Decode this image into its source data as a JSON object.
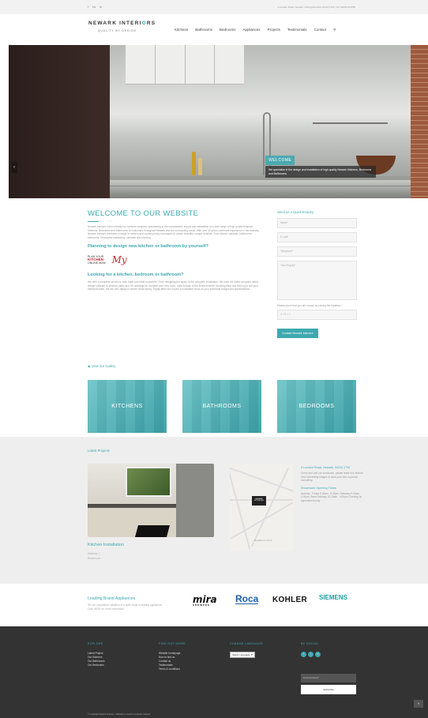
{
  "topbar": {
    "social": [
      "f",
      "tw",
      "in"
    ],
    "info": "4 London Road, Newark, Nottinghamshire NG24 1TW | Tel: 01636 611789"
  },
  "logo": {
    "name_a": "NEWARK INTERI",
    "name_b": "O",
    "name_c": "RS",
    "tagline": "QUALITY BY DESIGN"
  },
  "nav": [
    "Kitchens",
    "Bathrooms",
    "Bedrooms",
    "Appliances",
    "Projects",
    "Testimonials",
    "Contact"
  ],
  "hero": {
    "caption_title": "WELCOME",
    "caption_text": "We specialise in the design and installation of high quality Newark Kitchens, Bedrooms and Bathrooms"
  },
  "main": {
    "title": "WELCOME TO OUR WEBSITE",
    "intro": "Newark Interiors Ltd is a family run furniture company specialising in the manufacture, supply and installation of a wide range of high quality bespoke Kitchens, Bedrooms and Bathrooms to customers throughout Newark and the surrounding areas. With over 30 years combined experience in the industry, Newark Interiors combines a range of modern and contemporary techniques to create beautiful, unique furniture. From kitchen cabinets, bathrooms, bedrooms, to bespoke wardrobes, cabinets and shelving.",
    "plan_title": "Planning to design new kitchen or bathroom by yourself?",
    "kit_line1": "PLAN YOUR",
    "kit_line2": "KITCHEN",
    "kit_line3": "ONLINE NOW",
    "kit_brand": "My",
    "look_title": "Looking for a kitchen, bedroom or bathroom?",
    "look_text": "We offer a complete service to both trade and retail customers. From designing the layout to the complete installation. We have the latest computer aided design software to produce plans and 3D drawings for visualize your new room, right through to the finished article including tiling and flooring to suit your individual taste. We are also happy to advise those laying. Tightly fitted can expect a consistent focus on your individual budget and specifications."
  },
  "form": {
    "title": "Send us a Quick Enquiry",
    "name": "Name*",
    "email": "E-mail*",
    "telephone": "Telephone*",
    "company": "Your Enquiry*",
    "question": "Please prove that you are human by solving the equation *",
    "answer": "4 + 5 = ?",
    "button": "Contact Newark Interiors"
  },
  "gallery": {
    "link": "View our Gallery",
    "tiles": [
      "KITCHENS",
      "BATHROOMS",
      "BEDROOMS"
    ]
  },
  "projects": {
    "title": "Latest Projects",
    "project_name": "Kitchen Installation",
    "project_sub": "Kitchens, 1",
    "read_more": "Read more ›"
  },
  "map": {
    "pin": "NEWARK INTERIORS",
    "label": "Newark-on-Trent"
  },
  "contact": {
    "address": "4 London Road, Newark, NG24 1TW",
    "desc": "Come and visit our showroom, please leave it to feature new/ interesting images or lawn your free in-person consulting.",
    "hours_title": "Showroom Opening Times",
    "hours": "Monday - Friday 9.00am - 5.30pm, Saturday 9.00am - 1.00pm, Bank Holidays 10.00am - 4.00pm, Evening by appointment only"
  },
  "brands": {
    "title": "Leading Brand Appliances",
    "desc": "We are competitive installers of a wide range of leading appliances. Click HERE for more information.",
    "mira": "mira",
    "mira_sub": "SHOWERS",
    "roca": "Roca",
    "kohler": "KOHLER",
    "siemens": "SIEMENS"
  },
  "footer": {
    "explore_title": "EXPLORE",
    "explore": [
      "Latest Project",
      "Our Kitchens",
      "Our Bathrooms",
      "Our Bedrooms"
    ],
    "find_title": "FIND OUT MORE",
    "find": [
      "Website homepage",
      "How to find us",
      "Contact us",
      "Testimonials",
      "Terms & conditions"
    ],
    "lang_title": "CHANGE LANGUAGE",
    "lang_select": "Select Language  ▼",
    "social_title": "BE SOCIAL",
    "social": [
      "f",
      "t",
      "in"
    ],
    "email_placeholder": "Email Address*",
    "subscribe": "Subscribe",
    "copyright": "© Copyright Newark Interiors - Website by Search Computer Support"
  },
  "colors": {
    "accent": "#3fa9b0",
    "footer_bg": "#333333",
    "band_bg": "#eeeeee"
  }
}
